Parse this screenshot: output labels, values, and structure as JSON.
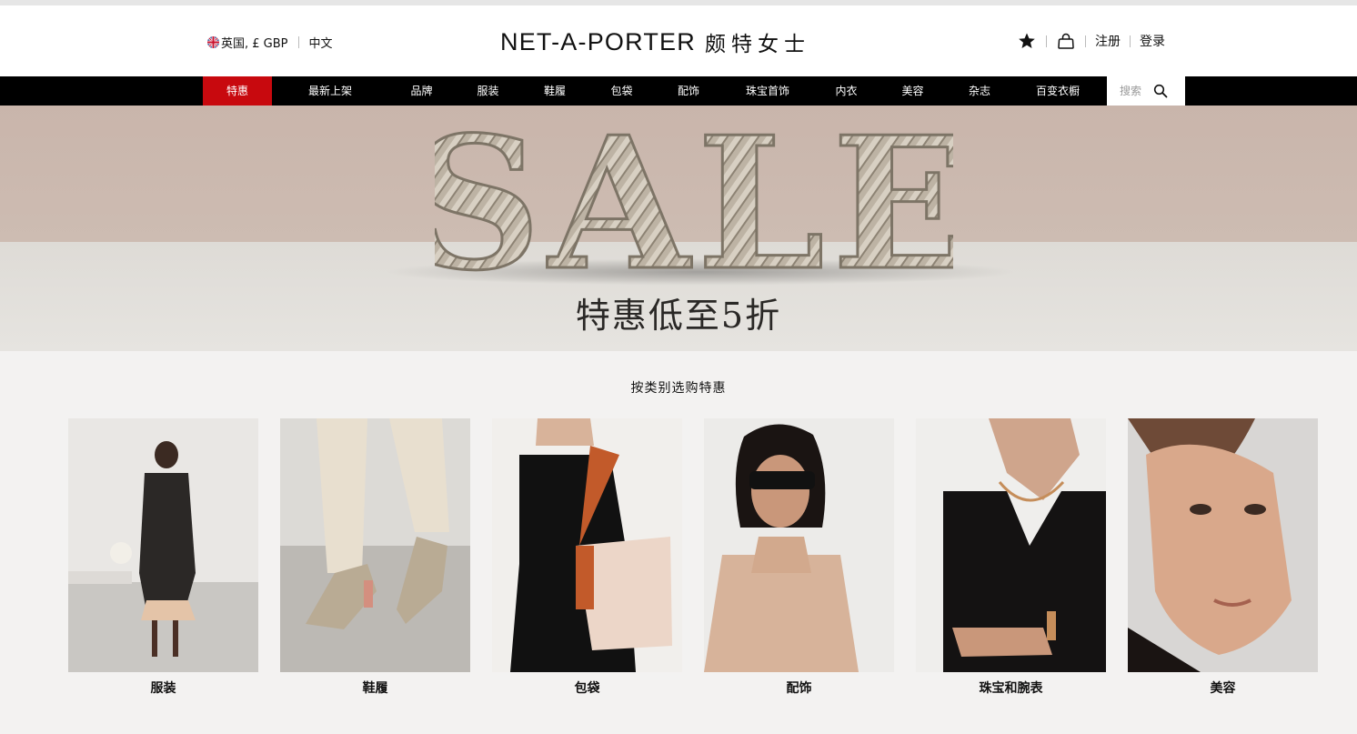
{
  "header": {
    "country": "英国, £ GBP",
    "language": "中文",
    "logo_en": "NET-A-PORTER",
    "logo_cn": "颇特女士",
    "register": "注册",
    "login": "登录",
    "icons": [
      "flag-uk-icon",
      "wishlist-star-icon",
      "shopping-bag-icon"
    ]
  },
  "nav": {
    "items": [
      {
        "label": "特惠",
        "active": true
      },
      {
        "label": "最新上架"
      },
      {
        "label": "品牌"
      },
      {
        "label": "服装"
      },
      {
        "label": "鞋履"
      },
      {
        "label": "包袋"
      },
      {
        "label": "配饰"
      },
      {
        "label": "珠宝首饰"
      },
      {
        "label": "内衣"
      },
      {
        "label": "美容"
      },
      {
        "label": "杂志"
      },
      {
        "label": "百变衣橱"
      }
    ],
    "search_placeholder": "搜索"
  },
  "hero": {
    "word": "SALE",
    "subtitle": "特惠低至5折"
  },
  "section_title": "按类别选购特惠",
  "categories": [
    {
      "label": "服装"
    },
    {
      "label": "鞋履"
    },
    {
      "label": "包袋"
    },
    {
      "label": "配饰"
    },
    {
      "label": "珠宝和腕表"
    },
    {
      "label": "美容"
    }
  ],
  "colors": {
    "accent_red": "#c8090e",
    "nav_bg": "#000000",
    "page_bg": "#f3f2f1",
    "hero_wall": "#c9b5ab",
    "hero_floor": "#e2dfdb"
  }
}
